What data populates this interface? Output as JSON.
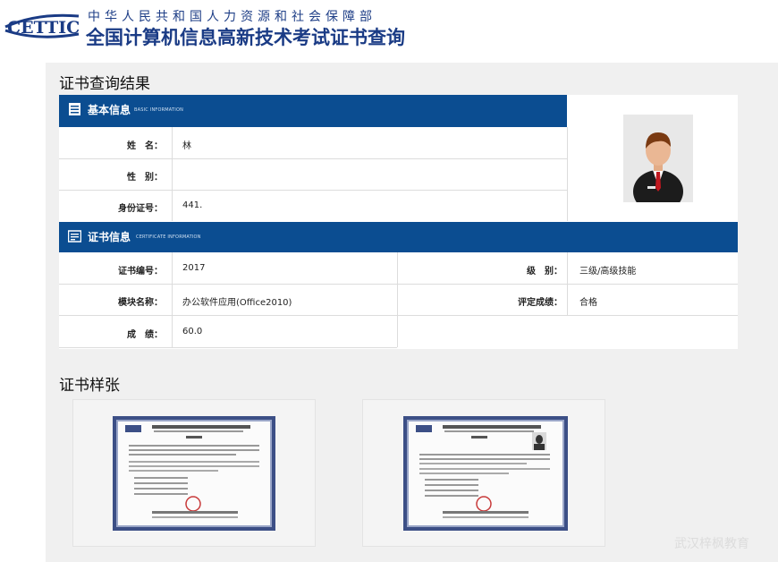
{
  "header": {
    "logo_text": "CETTIC",
    "ministry": "中华人民共和国人力资源和社会保障部",
    "title": "全国计算机信息高新技术考试证书查询"
  },
  "result_section": {
    "title": "证书查询结果"
  },
  "basic_info": {
    "title": "基本信息",
    "subtitle": "BASIC INFORMATION",
    "rows": [
      {
        "label": "姓　名：",
        "value": "林"
      },
      {
        "label": "性　别：",
        "value": ""
      },
      {
        "label": "身份证号：",
        "value": "441."
      }
    ]
  },
  "cert_info": {
    "title": "证书信息",
    "subtitle": "CERTIFICATE INFORMATION",
    "rows": [
      {
        "label": "证书编号：",
        "value": "2017",
        "label2": "级　别：",
        "value2": "三级/高级技能"
      },
      {
        "label": "模块名称：",
        "value": "办公软件应用(Office2010)",
        "label2": "评定成绩：",
        "value2": "合格"
      },
      {
        "label": "成　绩：",
        "value": "60.0"
      }
    ]
  },
  "sample_section": {
    "title": "证书样张"
  },
  "watermark": "武汉梓枫教育",
  "colors": {
    "brand_blue": "#0b4d91",
    "title_blue": "#1a3b85"
  }
}
